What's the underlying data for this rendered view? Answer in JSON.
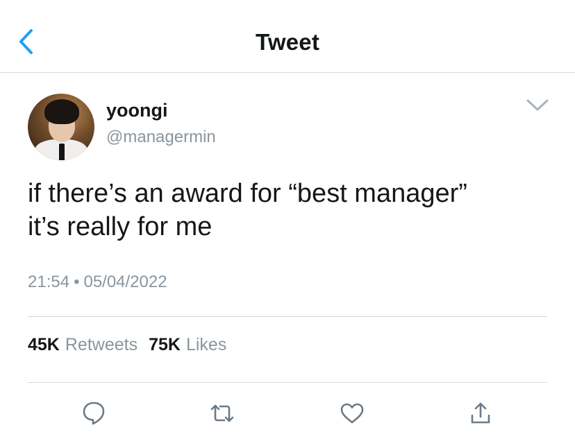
{
  "header": {
    "title": "Tweet",
    "back_icon": "chevron-left-icon",
    "accent_color": "#1da1f2"
  },
  "tweet": {
    "author_name": "yoongi",
    "author_handle": "@managermin",
    "text_lines": [
      "if there’s an award for “best manager”",
      "it’s really for me"
    ],
    "time": "21:54",
    "separator": "•",
    "date": "05/04/2022",
    "retweets_count": "45K",
    "retweets_label": "Retweets",
    "likes_count": "75K",
    "likes_label": "Likes"
  },
  "actions": {
    "reply_icon": "reply-icon",
    "retweet_icon": "retweet-icon",
    "like_icon": "heart-icon",
    "share_icon": "share-icon"
  },
  "colors": {
    "text": "#14171a",
    "muted": "#8a959e",
    "divider": "#d6d9dc",
    "icon": "#6b7a87"
  }
}
